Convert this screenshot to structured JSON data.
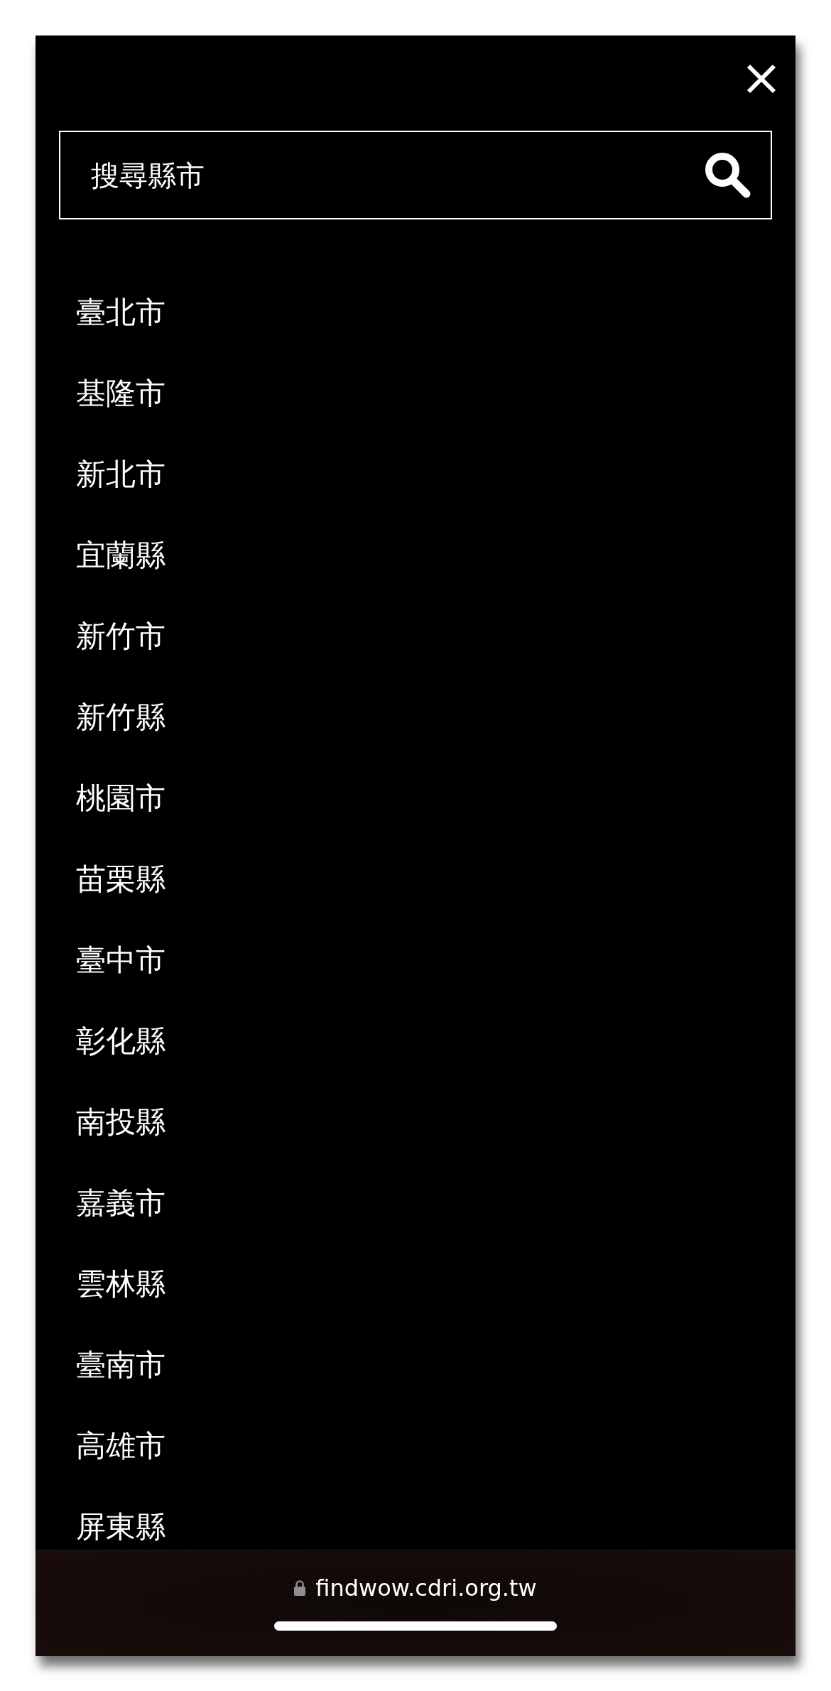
{
  "search": {
    "placeholder": "搜尋縣市"
  },
  "cities": [
    "臺北市",
    "基隆市",
    "新北市",
    "宜蘭縣",
    "新竹市",
    "新竹縣",
    "桃園市",
    "苗栗縣",
    "臺中市",
    "彰化縣",
    "南投縣",
    "嘉義市",
    "雲林縣",
    "臺南市",
    "高雄市",
    "屏東縣"
  ],
  "browser_bar": {
    "url": "findwow.cdri.org.tw"
  }
}
